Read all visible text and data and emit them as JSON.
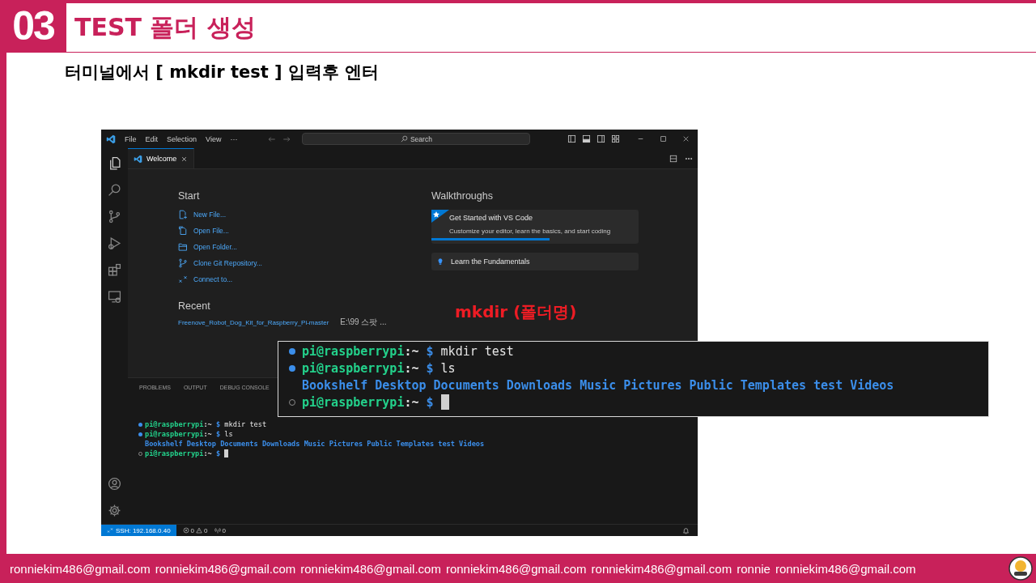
{
  "slide": {
    "number": "03",
    "title": "TEST 폴더 생성",
    "instruction": "터미널에서 [ mkdir test ] 입력후 엔터"
  },
  "vscode": {
    "menu": [
      "File",
      "Edit",
      "Selection",
      "View",
      "···"
    ],
    "search": {
      "label": "Search"
    },
    "tabs": [
      {
        "label": "Welcome",
        "selected": true
      }
    ],
    "start": {
      "heading": "Start",
      "items": [
        {
          "label": "New File...",
          "kind": "new-file"
        },
        {
          "label": "Open File...",
          "kind": "open-file"
        },
        {
          "label": "Open Folder...",
          "kind": "open-folder"
        },
        {
          "label": "Clone Git Repository...",
          "kind": "clone"
        },
        {
          "label": "Connect to...",
          "kind": "connect"
        }
      ]
    },
    "recent": {
      "heading": "Recent",
      "items": [
        {
          "name": "Freenove_Robot_Dog_Kit_for_Raspberry_Pi-master",
          "path": "E:\\99 스팟 ..."
        }
      ]
    },
    "walkthroughs": {
      "heading": "Walkthroughs",
      "items": [
        {
          "kind": "featured",
          "title": "Get Started with VS Code",
          "description": "Customize your editor, learn the basics, and start coding",
          "level": 0.57
        },
        {
          "kind": "basic",
          "title": "Learn the Fundamentals"
        }
      ]
    },
    "panel": {
      "tabs": [
        {
          "label": "PROBLEMS",
          "selected": false
        },
        {
          "label": "OUTPUT",
          "selected": false
        },
        {
          "label": "DEBUG CONSOLE",
          "selected": false
        }
      ],
      "terminal": {
        "lines": [
          {
            "kind": "prompt",
            "succeeded": true,
            "user": "pi@raspberrypi",
            "path": ":~",
            "symbol": "$",
            "command": "mkdir test",
            "cursor": false
          },
          {
            "kind": "prompt",
            "succeeded": true,
            "user": "pi@raspberrypi",
            "path": ":~",
            "symbol": "$",
            "command": "ls",
            "cursor": false
          },
          {
            "kind": "output",
            "entries": [
              "Bookshelf",
              "Desktop",
              "Documents",
              "Downloads",
              "Music",
              "Pictures",
              "Public",
              "Templates",
              "test",
              "Videos"
            ]
          },
          {
            "kind": "prompt",
            "succeeded": false,
            "user": "pi@raspberrypi",
            "path": ":~",
            "symbol": "$",
            "cursor": true
          }
        ]
      }
    },
    "status_bar": {
      "remote": "SSH: 192.168.0.40",
      "errors": "0",
      "warnings": "0",
      "ports": "0"
    }
  },
  "annotation": "mkdir (폴더명)",
  "zoomed_terminal": {
    "lines": [
      {
        "kind": "prompt",
        "succeeded": true,
        "user": "pi@raspberrypi",
        "path": ":~",
        "symbol": "$",
        "command": "mkdir test",
        "cursor": false
      },
      {
        "kind": "prompt",
        "succeeded": true,
        "user": "pi@raspberrypi",
        "path": ":~",
        "symbol": "$",
        "command": "ls",
        "cursor": false
      },
      {
        "kind": "output",
        "entries": [
          "Bookshelf",
          "Desktop",
          "Documents",
          "Downloads",
          "Music",
          "Pictures",
          "Public",
          "Templates",
          "test",
          "Videos"
        ]
      },
      {
        "kind": "prompt",
        "succeeded": false,
        "user": "pi@raspberrypi",
        "path": ":~",
        "symbol": "$",
        "cursor": true
      }
    ]
  },
  "footer": {
    "items": [
      "ronniekim486@gmail.com",
      "ronniekim486@gmail.com",
      "ronniekim486@gmail.com",
      "ronniekim486@gmail.com",
      "ronniekim486@gmail.com",
      "ronnie",
      "ronniekim486@gmail.com"
    ]
  }
}
